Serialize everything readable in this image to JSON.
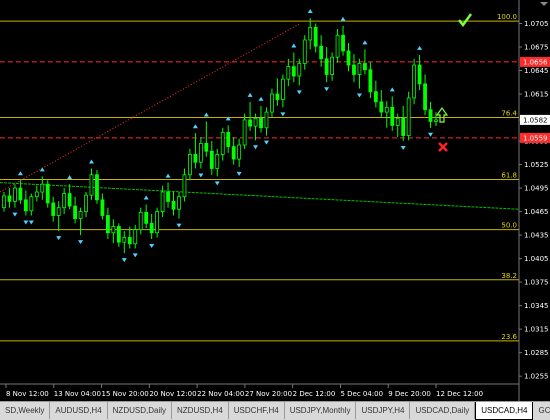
{
  "colors": {
    "background": "#000000",
    "bull": "#00ff00",
    "bear": "#00ff00",
    "fib_line": "#c8b400",
    "red_line": "#ff2a2a",
    "signal_up": "#4fd0ff",
    "ma_line": "#00c000",
    "check": "#7cff3b",
    "cross": "#ff2222"
  },
  "price_axis": {
    "labels": [
      "1.0705",
      "1.0675",
      "1.0645",
      "1.0615",
      "1.0582",
      "1.0555",
      "1.0525",
      "1.0495",
      "1.0465",
      "1.0435",
      "1.0405",
      "1.0375",
      "1.0345",
      "1.0315",
      "1.0285",
      "1.0255"
    ],
    "badges": [
      {
        "text": "1.0656",
        "color": "#ff2a2a"
      },
      {
        "text": "1.0582",
        "color": "#ffffff"
      },
      {
        "text": "1.0559",
        "color": "#ff2a2a"
      }
    ]
  },
  "time_axis": {
    "labels": [
      "8 Nov 12:00",
      "13 Nov 04:00",
      "15 Nov 20:00",
      "20 Nov 12:00",
      "22 Nov 04:00",
      "27 Nov 20:00",
      "2 Dec 12:00",
      "5 Dec 04:00",
      "9 Dec 20:00",
      "12 Dec 12:00"
    ]
  },
  "fib_levels": [
    {
      "label": "100.0",
      "price": 1.0708
    },
    {
      "label": "76.4",
      "price": 1.0585
    },
    {
      "label": "61.8",
      "price": 1.0506
    },
    {
      "label": "50.0",
      "price": 1.0442
    },
    {
      "label": "38.2",
      "price": 1.0378
    },
    {
      "label": "23.6",
      "price": 1.03
    }
  ],
  "red_levels": [
    {
      "price": 1.0656
    },
    {
      "price": 1.0559
    }
  ],
  "chart_data": {
    "type": "candlestick",
    "symbol": "USDCAD,H4",
    "ylim": [
      1.0245,
      1.0735
    ],
    "candles": [
      [
        1.047,
        1.049,
        1.0465,
        1.0485
      ],
      [
        1.0485,
        1.0495,
        1.047,
        1.0478
      ],
      [
        1.0478,
        1.05,
        1.047,
        1.0495
      ],
      [
        1.0495,
        1.0505,
        1.0475,
        1.048
      ],
      [
        1.048,
        1.0492,
        1.046,
        1.0466
      ],
      [
        1.0466,
        1.0488,
        1.046,
        1.0484
      ],
      [
        1.0484,
        1.0498,
        1.0478,
        1.049
      ],
      [
        1.049,
        1.051,
        1.048,
        1.05
      ],
      [
        1.05,
        1.0505,
        1.047,
        1.0476
      ],
      [
        1.0476,
        1.0484,
        1.0452,
        1.046
      ],
      [
        1.046,
        1.0478,
        1.044,
        1.047
      ],
      [
        1.047,
        1.0495,
        1.0462,
        1.0488
      ],
      [
        1.0488,
        1.05,
        1.0468,
        1.0472
      ],
      [
        1.0472,
        1.0484,
        1.045,
        1.0456
      ],
      [
        1.0456,
        1.047,
        1.0435,
        1.0465
      ],
      [
        1.0465,
        1.049,
        1.0458,
        1.0486
      ],
      [
        1.0486,
        1.052,
        1.048,
        1.0512
      ],
      [
        1.0512,
        1.0518,
        1.0475,
        1.048
      ],
      [
        1.048,
        1.0488,
        1.0455,
        1.046
      ],
      [
        1.046,
        1.047,
        1.043,
        1.0438
      ],
      [
        1.0438,
        1.0455,
        1.0425,
        1.0446
      ],
      [
        1.0446,
        1.045,
        1.042,
        1.0426
      ],
      [
        1.0426,
        1.044,
        1.0412,
        1.0432
      ],
      [
        1.0432,
        1.0446,
        1.0418,
        1.0424
      ],
      [
        1.0424,
        1.0448,
        1.0418,
        1.0442
      ],
      [
        1.0442,
        1.047,
        1.0436,
        1.0464
      ],
      [
        1.0464,
        1.0474,
        1.0444,
        1.045
      ],
      [
        1.045,
        1.0462,
        1.043,
        1.0438
      ],
      [
        1.0438,
        1.047,
        1.0432,
        1.0465
      ],
      [
        1.0465,
        1.0498,
        1.0458,
        1.049
      ],
      [
        1.049,
        1.0502,
        1.047,
        1.0478
      ],
      [
        1.0478,
        1.049,
        1.046,
        1.0468
      ],
      [
        1.0468,
        1.049,
        1.0456,
        1.0484
      ],
      [
        1.0484,
        1.052,
        1.0478,
        1.0512
      ],
      [
        1.0512,
        1.0545,
        1.0505,
        1.0538
      ],
      [
        1.0538,
        1.0565,
        1.052,
        1.0528
      ],
      [
        1.0528,
        1.056,
        1.052,
        1.0552
      ],
      [
        1.0552,
        1.058,
        1.0535,
        1.0542
      ],
      [
        1.0542,
        1.0555,
        1.0512,
        1.052
      ],
      [
        1.052,
        1.0545,
        1.051,
        1.0538
      ],
      [
        1.0538,
        1.0572,
        1.053,
        1.0566
      ],
      [
        1.0566,
        1.0575,
        1.054,
        1.0548
      ],
      [
        1.0548,
        1.056,
        1.0525,
        1.0532
      ],
      [
        1.0532,
        1.0558,
        1.0522,
        1.055
      ],
      [
        1.055,
        1.059,
        1.0545,
        1.0582
      ],
      [
        1.0582,
        1.0605,
        1.0568,
        1.0574
      ],
      [
        1.0574,
        1.059,
        1.0556,
        1.0584
      ],
      [
        1.0584,
        1.06,
        1.0566,
        1.0572
      ],
      [
        1.0572,
        1.0598,
        1.0562,
        1.0592
      ],
      [
        1.0592,
        1.0622,
        1.0586,
        1.0615
      ],
      [
        1.0615,
        1.0635,
        1.06,
        1.0608
      ],
      [
        1.0608,
        1.064,
        1.0598,
        1.0634
      ],
      [
        1.0634,
        1.066,
        1.0625,
        1.065
      ],
      [
        1.065,
        1.0668,
        1.063,
        1.0638
      ],
      [
        1.0638,
        1.066,
        1.0626,
        1.0654
      ],
      [
        1.0654,
        1.069,
        1.0646,
        1.0684
      ],
      [
        1.0684,
        1.0712,
        1.0672,
        1.07
      ],
      [
        1.07,
        1.0705,
        1.0668,
        1.0676
      ],
      [
        1.0676,
        1.069,
        1.065,
        1.066
      ],
      [
        1.066,
        1.0675,
        1.063,
        1.064
      ],
      [
        1.064,
        1.0668,
        1.0632,
        1.0662
      ],
      [
        1.0662,
        1.0698,
        1.0655,
        1.069
      ],
      [
        1.069,
        1.0702,
        1.0664,
        1.067
      ],
      [
        1.067,
        1.068,
        1.0644,
        1.0652
      ],
      [
        1.0652,
        1.0666,
        1.063,
        1.064
      ],
      [
        1.064,
        1.066,
        1.0622,
        1.0654
      ],
      [
        1.0654,
        1.0672,
        1.064,
        1.0646
      ],
      [
        1.0646,
        1.0656,
        1.061,
        1.0618
      ],
      [
        1.0618,
        1.0632,
        1.0598,
        1.0605
      ],
      [
        1.0605,
        1.062,
        1.0586,
        1.0592
      ],
      [
        1.0592,
        1.0606,
        1.0572,
        1.0598
      ],
      [
        1.0598,
        1.0612,
        1.0568,
        1.0575
      ],
      [
        1.0575,
        1.059,
        1.056,
        1.0584
      ],
      [
        1.0584,
        1.06,
        1.0555,
        1.0562
      ],
      [
        1.0562,
        1.0618,
        1.0556,
        1.061
      ],
      [
        1.061,
        1.066,
        1.0602,
        1.0652
      ],
      [
        1.0652,
        1.0665,
        1.062,
        1.0628
      ],
      [
        1.0628,
        1.064,
        1.0588,
        1.0595
      ],
      [
        1.0595,
        1.0605,
        1.0572,
        1.058
      ],
      [
        1.058,
        1.0592,
        1.0574,
        1.0582
      ]
    ]
  },
  "tabs": [
    {
      "label": "SD,Weekly"
    },
    {
      "label": "AUDUSD,H4"
    },
    {
      "label": "NZDUSD,Daily"
    },
    {
      "label": "NZDUSD,H4"
    },
    {
      "label": "USDCHF,H4"
    },
    {
      "label": "USDJPY,Monthly"
    },
    {
      "label": "USDJPY,H4"
    },
    {
      "label": "USDCAD,Daily"
    },
    {
      "label": "USDCAD,H4",
      "active": true
    },
    {
      "label": "GC"
    }
  ]
}
